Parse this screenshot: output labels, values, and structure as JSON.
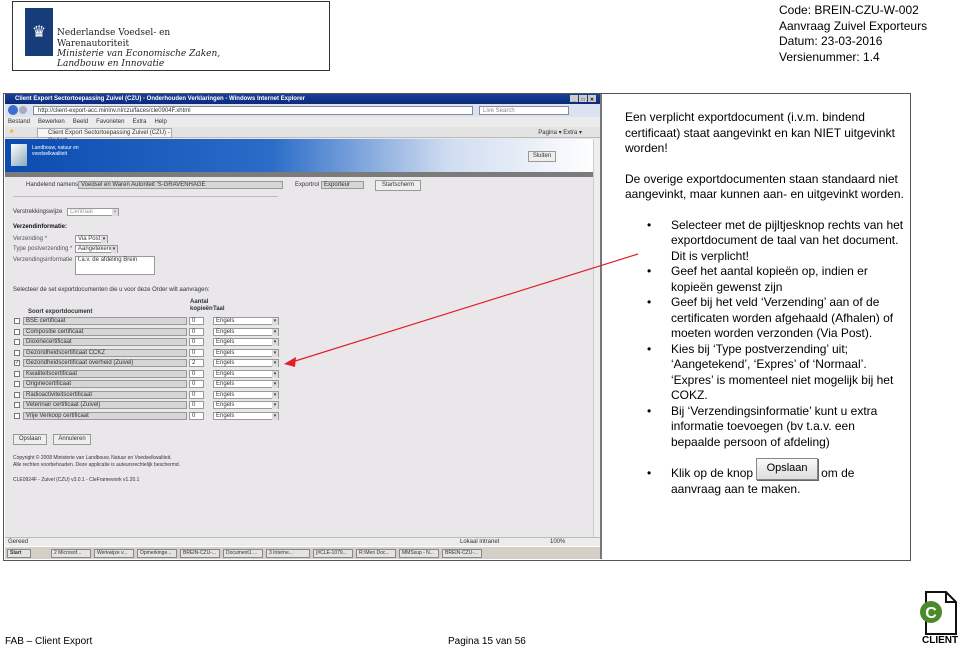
{
  "header": {
    "org_line1": "Nederlandse Voedsel- en",
    "org_line2": "Warenautoriteit",
    "ministry_line1": "Ministerie van Economische Zaken,",
    "ministry_line2": "Landbouw en Innovatie",
    "code": "Code: BREIN-CZU-W-002",
    "subject": "Aanvraag Zuivel Exporteurs",
    "date": "Datum: 23-03-2016",
    "version": "Versienummer: 1.4"
  },
  "browser": {
    "title": "Client Export Sectortoepassing Zuivel (CZU) - Onderhouden Verklaringen - Windows Internet Explorer",
    "url": "http://client-export-acc.minlnv.nl/czu/faces/cle0904F.xhtml",
    "search_placeholder": "Live Search",
    "menu": [
      "Bestand",
      "Bewerken",
      "Beeld",
      "Favorieten",
      "Extra",
      "Help"
    ],
    "tab": "Client Export Sectortoepassing Zuivel (CZU) - Onderh...",
    "tools": "Pagina ▾  Extra ▾",
    "status": "Gereed",
    "zone": "Lokaal intranet",
    "zoom": "100%"
  },
  "app": {
    "banner_text": "Landbouw, natuur en voedselkwaliteit",
    "close_button": "Sluiten",
    "applicant_label": "Handelend namens",
    "applicant_value": "Voedsel en Waren Autoriteit 'S-GRAVENHAGE",
    "role_label": "Exportrol",
    "role_value": "Exporteur",
    "start_button": "Startscherm",
    "delivery_label": "Verstrekkingswijze",
    "delivery_value": "Centraal",
    "shipping_heading": "Verzendinformatie:",
    "shipping_label": "Verzending *",
    "shipping_value": "Via Post",
    "post_type_label": "Type postverzending *",
    "post_type_value": "Aangetekend",
    "shipping_info_label": "Verzendingsinformatie",
    "shipping_info_value": "t.a.v. de afdeling Brein",
    "select_instruction": "Selecteer de set exportdocumenten die u voor deze Order wilt aanvragen:",
    "col_doc": "Soort exportdocument",
    "col_count_1": "Aantal",
    "col_count_2": "kopieën",
    "col_lang": "Taal",
    "documents": [
      {
        "name": "BSE certificaat",
        "checked": false,
        "count": "0",
        "lang": "Engels"
      },
      {
        "name": "Compositie certificaat",
        "checked": false,
        "count": "0",
        "lang": "Engels"
      },
      {
        "name": "Dioxinecertificaat",
        "checked": false,
        "count": "0",
        "lang": "Engels"
      },
      {
        "name": "Gezondheidscertificaat CCKZ",
        "checked": false,
        "count": "0",
        "lang": "Engels"
      },
      {
        "name": "Gezondheidscertificaat overheid (Zuivel)",
        "checked": true,
        "count": "2",
        "lang": "Engels"
      },
      {
        "name": "Kwaliteitscertificaat",
        "checked": false,
        "count": "0",
        "lang": "Engels"
      },
      {
        "name": "Originecertificaat",
        "checked": false,
        "count": "0",
        "lang": "Engels"
      },
      {
        "name": "Radioactiviteitscertificaat",
        "checked": false,
        "count": "0",
        "lang": "Engels"
      },
      {
        "name": "Veterinair certificaat (Zuivel)",
        "checked": false,
        "count": "0",
        "lang": "Engels"
      },
      {
        "name": "Vrije Verkoop certificaat",
        "checked": false,
        "count": "0",
        "lang": "Engels"
      }
    ],
    "save_button": "Opslaan",
    "cancel_button": "Annuleren",
    "copyright_1": "Copyright © 2008 Ministerie van Landbouw, Natuur en Voedselkwaliteit.",
    "copyright_2": "Alle rechten voorbehouden. Deze applicatie is auteursrechtelijk beschermd.",
    "version": "CLE0924F - Zuivel (CZU) v3.0.1 - CleFramework v1.20.1"
  },
  "taskbar": [
    "Start",
    "2 Microsof...",
    "Werkwijze v...",
    "Opmerkinge...",
    "BREIN-CZU-...",
    "Document1 ...",
    "3 Interne...",
    "[#CLE-1079...",
    "R:\\Men Doc...",
    "MMSsup - N...",
    "BREIN-CZU-..."
  ],
  "explanation": {
    "intro1": "Een verplicht exportdocument (i.v.m. bindend certificaat) staat aangevinkt en kan NIET uitgevinkt worden!",
    "intro2": "De overige exportdocumenten staan standaard niet aangevinkt, maar kunnen aan- en uitgevinkt worden.",
    "bullets": [
      "Selecteer met de pijltjesknop rechts van het exportdocument de taal van het document. Dit is verplicht!",
      "Geef het aantal kopieën op, indien er kopieën gewenst zijn",
      "Geef bij het veld ‘Verzending’ aan of de certificaten worden afgehaald (Afhalen) of moeten worden verzonden (Via Post).",
      "Kies bij ‘Type postverzending’ uit; ‘Aangetekend’, ‘Expres’ of ‘Normaal’. ‘Expres’ is momenteel niet mogelijk bij het COKZ.",
      "Bij ‘Verzendingsinformatie’ kunt u extra informatie toevoegen (bv t.a.v. een bepaalde persoon of afdeling)"
    ],
    "last_pre": "Klik op de knop",
    "last_button": "Opslaan",
    "last_post": "om de aanvraag aan te maken."
  },
  "footer": {
    "left": "FAB – Client Export",
    "center": "Pagina 15 van 56",
    "logo_text": "CLIENT"
  },
  "colors": {
    "arrow": "#e0202a",
    "ie_title": "#0b2a78",
    "logo": "#163d7a",
    "client_green": "#4a8a2a"
  }
}
